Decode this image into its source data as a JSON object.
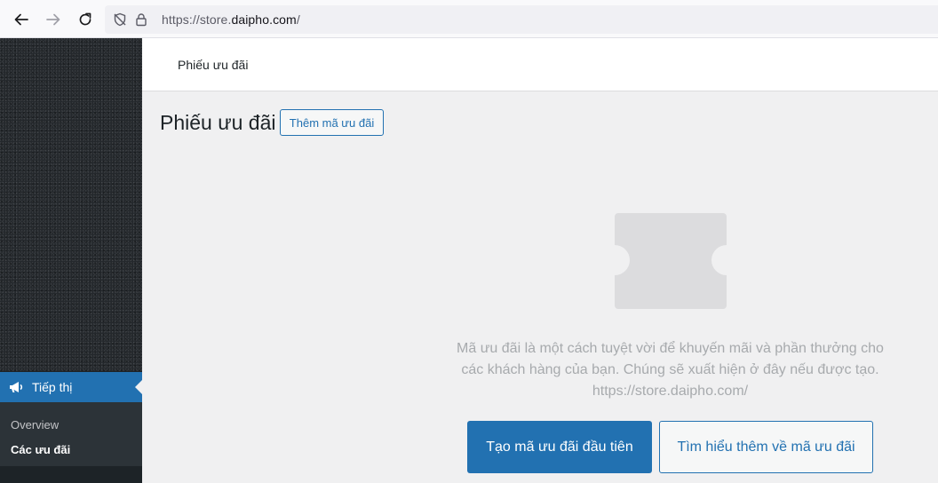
{
  "browser": {
    "url_scheme": "https://store.",
    "url_host": "daipho.com",
    "url_path": "/"
  },
  "sidebar": {
    "menu_item": {
      "label": "Tiếp thị",
      "icon": "megaphone-icon"
    },
    "submenu": [
      {
        "label": "Overview"
      },
      {
        "label": "Các ưu đãi"
      }
    ]
  },
  "topbar": {
    "title": "Phiếu ưu đãi"
  },
  "main": {
    "title": "Phiếu ưu đãi",
    "add_button": "Thêm mã ưu đãi",
    "empty_lines": [
      "Mã ưu đãi là một cách tuyệt vời để khuyến mãi và phần thưởng cho",
      "các khách hàng của bạn. Chúng sẽ xuất hiện ở đây nếu được tạo.",
      "https://store.daipho.com/"
    ],
    "primary_button": "Tạo mã ưu đãi đầu tiên",
    "secondary_button": "Tìm hiểu thêm về mã ưu đãi"
  },
  "colors": {
    "accent": "#2271b1",
    "sidebar": "#1d2327",
    "muted_text": "#a7aaad"
  }
}
